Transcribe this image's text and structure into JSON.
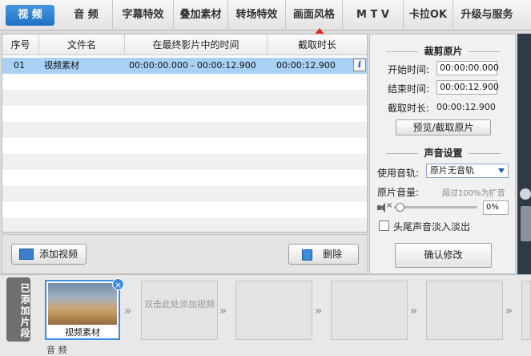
{
  "tabs": [
    {
      "label": "视 频",
      "active": true
    },
    {
      "label": "音 频"
    },
    {
      "label": "字幕特效"
    },
    {
      "label": "叠加素材"
    },
    {
      "label": "转场特效"
    },
    {
      "label": "画面风格"
    },
    {
      "label": "M T V"
    },
    {
      "label": "卡拉OK"
    },
    {
      "label": "升级与服务"
    }
  ],
  "filelist": {
    "columns": [
      "序号",
      "文件名",
      "在最终影片中的时间",
      "截取时长"
    ],
    "rows": [
      {
        "index": "01",
        "name": "视频素材",
        "time": "00:00:00.000 - 00:00:12.900",
        "duration": "00:00:12.900"
      }
    ],
    "info_icon": "info-icon"
  },
  "crop": {
    "title": "裁剪原片",
    "start_label": "开始时间:",
    "start_value": "00:00:00.000",
    "end_label": "结束时间:",
    "end_value": "00:00:12.900",
    "duration_label": "截取时长:",
    "duration_value": "00:00:12.900",
    "preview_button": "预览/截取原片"
  },
  "audio": {
    "title": "声音设置",
    "track_label": "使用音轨:",
    "track_value": "原片无音轨",
    "volume_label": "原片音量:",
    "volume_hint": "超过100%为扩音",
    "volume_value": "0%",
    "volume_fraction": 0,
    "fade_label": "头尾声音淡入淡出",
    "confirm_button": "确认修改"
  },
  "actions": {
    "add_video": "添加视频",
    "delete": "删除"
  },
  "timeline": {
    "section_label": "已添加片段",
    "first_clip_name": "视频素材",
    "empty_hint": "双击此处添加视频",
    "audio_label": "音 频"
  },
  "colors": {
    "accent": "#1f6fc4",
    "selection": "#a9d0f5"
  }
}
